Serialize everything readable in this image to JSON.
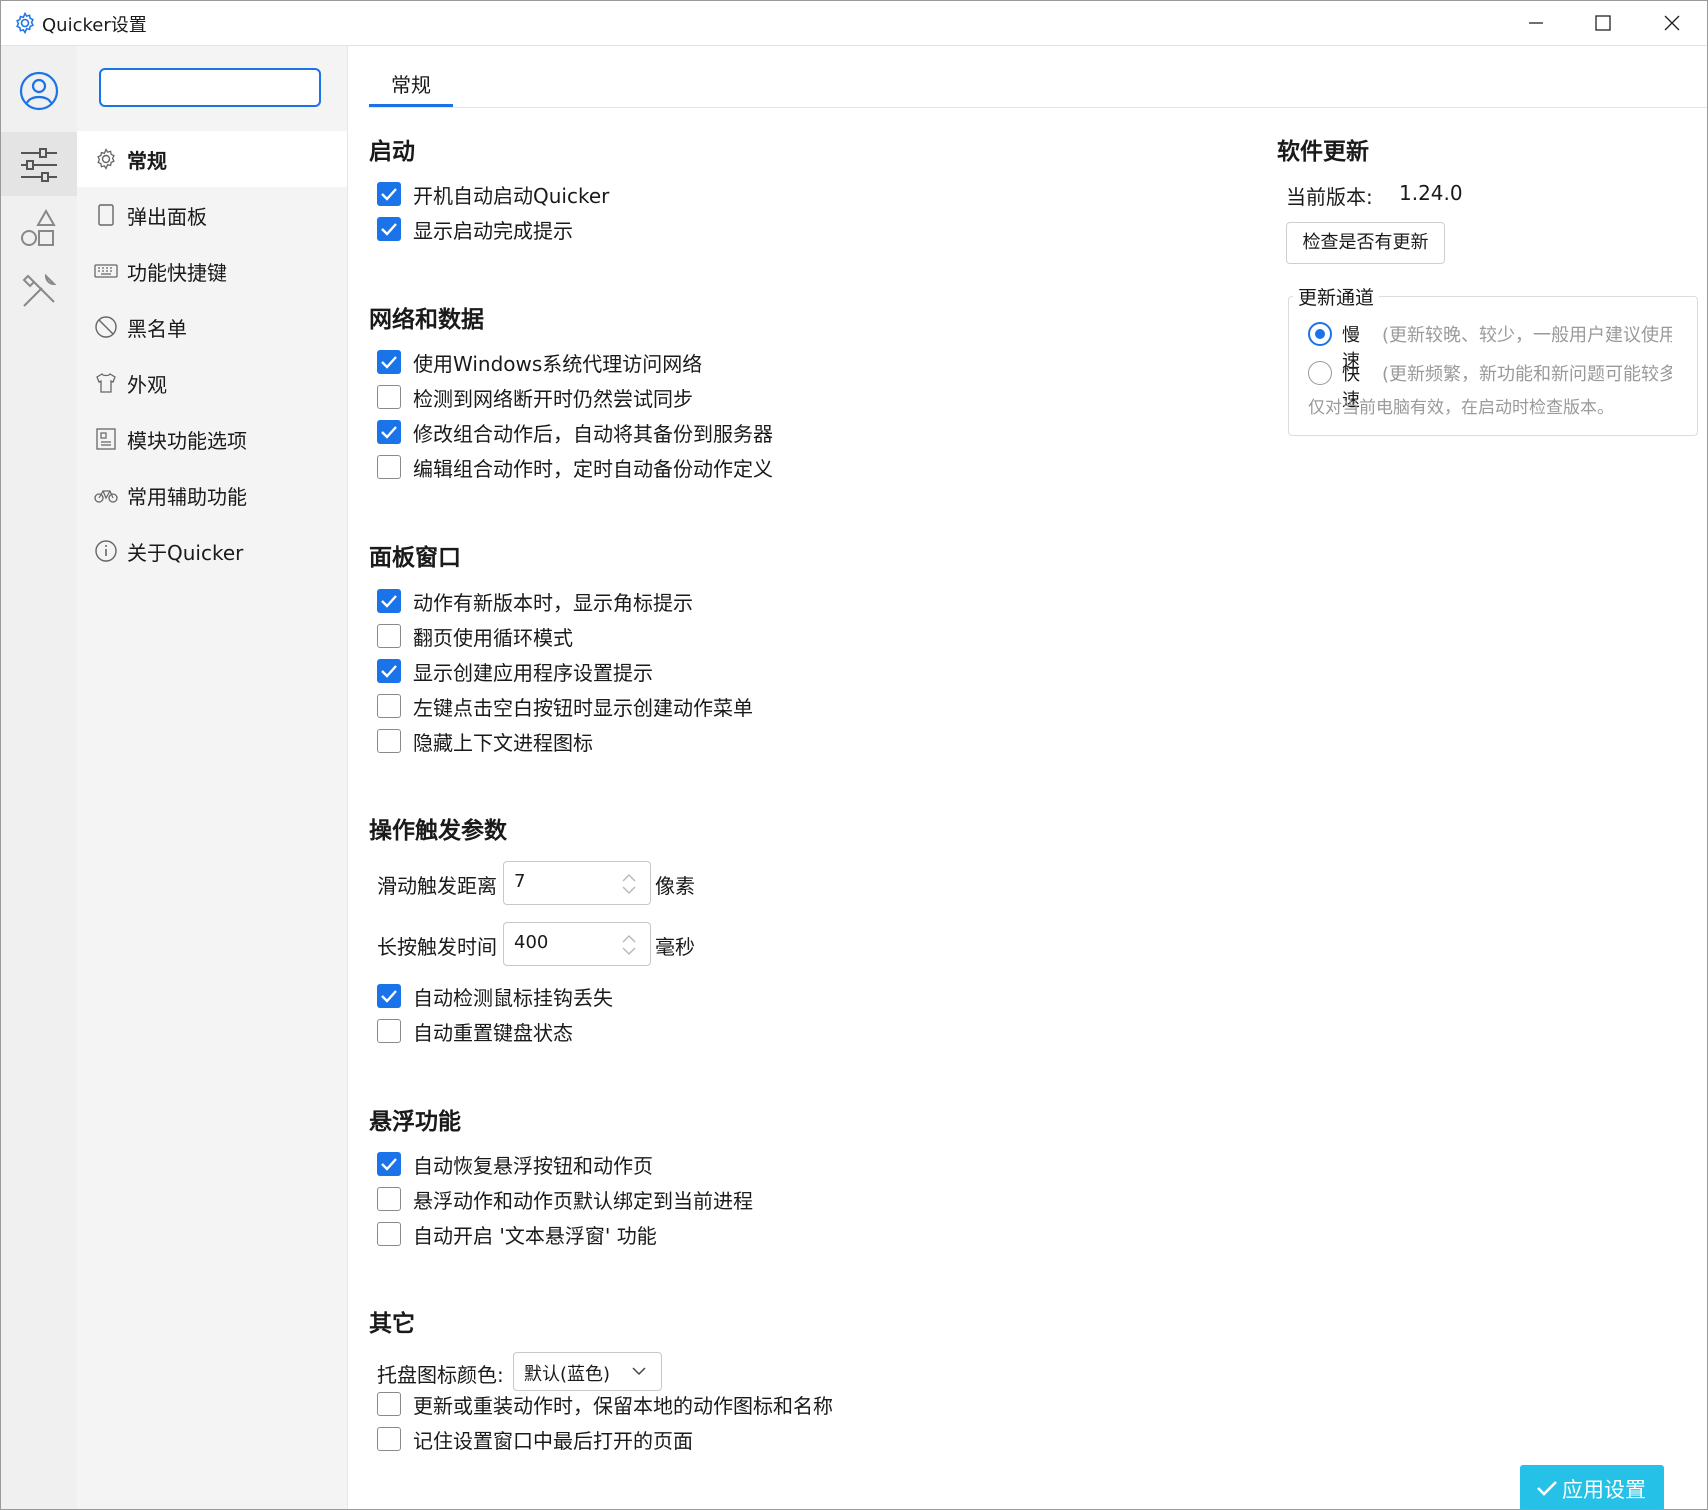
{
  "window": {
    "title": "Quicker设置"
  },
  "nav": {
    "search_value": "",
    "items": [
      {
        "label": "常规",
        "icon": "gear-icon",
        "active": true
      },
      {
        "label": "弹出面板",
        "icon": "panel-icon"
      },
      {
        "label": "功能快捷键",
        "icon": "keyboard-icon"
      },
      {
        "label": "黑名单",
        "icon": "block-icon"
      },
      {
        "label": "外观",
        "icon": "shirt-icon"
      },
      {
        "label": "模块功能选项",
        "icon": "module-icon"
      },
      {
        "label": "常用辅助功能",
        "icon": "bike-icon"
      },
      {
        "label": "关于Quicker",
        "icon": "info-icon"
      }
    ]
  },
  "rail": {
    "icons": [
      "user-icon",
      "sliders-icon",
      "shapes-icon",
      "tools-icon"
    ]
  },
  "tab": {
    "label": "常规"
  },
  "sections": {
    "startup": {
      "title": "启动",
      "options": [
        {
          "label": "开机自动启动Quicker",
          "checked": true
        },
        {
          "label": "显示启动完成提示",
          "checked": true
        }
      ]
    },
    "network": {
      "title": "网络和数据",
      "options": [
        {
          "label": "使用Windows系统代理访问网络",
          "checked": true
        },
        {
          "label": "检测到网络断开时仍然尝试同步",
          "checked": false
        },
        {
          "label": "修改组合动作后，自动将其备份到服务器",
          "checked": true
        },
        {
          "label": "编辑组合动作时，定时自动备份动作定义",
          "checked": false
        }
      ]
    },
    "panel": {
      "title": "面板窗口",
      "options": [
        {
          "label": "动作有新版本时，显示角标提示",
          "checked": true
        },
        {
          "label": "翻页使用循环模式",
          "checked": false
        },
        {
          "label": "显示创建应用程序设置提示",
          "checked": true
        },
        {
          "label": "左键点击空白按钮时显示创建动作菜单",
          "checked": false
        },
        {
          "label": "隐藏上下文进程图标",
          "checked": false
        }
      ]
    },
    "trigger": {
      "title": "操作触发参数",
      "swipe_label": "滑动触发距离",
      "swipe_value": "7",
      "swipe_unit": "像素",
      "press_label": "长按触发时间",
      "press_value": "400",
      "press_unit": "毫秒",
      "options": [
        {
          "label": "自动检测鼠标挂钩丢失",
          "checked": true
        },
        {
          "label": "自动重置键盘状态",
          "checked": false
        }
      ]
    },
    "floating": {
      "title": "悬浮功能",
      "options": [
        {
          "label": "自动恢复悬浮按钮和动作页",
          "checked": true
        },
        {
          "label": "悬浮动作和动作页默认绑定到当前进程",
          "checked": false
        },
        {
          "label": "自动开启 '文本悬浮窗' 功能",
          "checked": false
        }
      ]
    },
    "other": {
      "title": "其它",
      "tray_label": "托盘图标颜色:",
      "tray_value": "默认(蓝色)",
      "options": [
        {
          "label": "更新或重装动作时，保留本地的动作图标和名称",
          "checked": false
        },
        {
          "label": "记住设置窗口中最后打开的页面",
          "checked": false
        }
      ]
    }
  },
  "update": {
    "title": "软件更新",
    "version_label": "当前版本:",
    "version_value": "1.24.0",
    "check_button": "检查是否有更新",
    "channel_title": "更新通道",
    "channels": [
      {
        "name": "慢速",
        "desc": "(更新较晚、较少，一般用户建议使用",
        "selected": true
      },
      {
        "name": "快速",
        "desc": "(更新频繁，新功能和新问题可能较多",
        "selected": false
      }
    ],
    "note": "仅对当前电脑有效，在启动时检查版本。"
  },
  "apply_button": "应用设置",
  "colors": {
    "accent": "#1a73e8",
    "apply": "#26c1e6"
  }
}
